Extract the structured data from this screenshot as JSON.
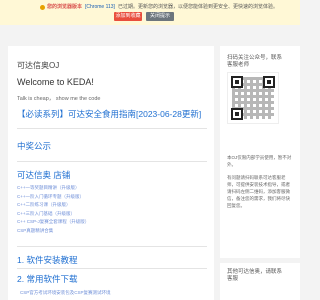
{
  "warning": {
    "title": "您的浏览器版本",
    "browser": "[Chrome 113]",
    "text": "已过期。更新您的浏览器，以便您能体验到更安全、更快速的浏览体验。",
    "add_fav_label": "添加到收藏",
    "close_label": "关闭提示"
  },
  "main": {
    "site_title": "可达信奥OJ",
    "welcome": "Welcome to KEDA!",
    "motto": "Talk is cheap， show me the code",
    "notice": "【必读系列】可达安全食用指南[2023-06-28更新]",
    "announcement_title": "中奖公示",
    "shop_title": "可达信奥 店铺",
    "shop_items": [
      "C++一等奖题目精讲（升级版）",
      "C++一阶入门循环专题（升级版）",
      "C++二阶练习课（升级版）",
      "C++三阶入门基础（升级版）",
      "C++ CSP-J复赛全套课程（升级版）",
      "CSP真题精讲合集"
    ],
    "section1": "1. 软件安装教程",
    "section2": "2. 常用软件下载",
    "resource_item": "CSP官方考试环境安装包及CSP复赛测试环境"
  },
  "sidebar": {
    "qr_title": "扫码关注公众号，联系客服老师",
    "notice_text": "本OJ仅限内部学员使用，暂不对外。",
    "notice_text2": "有问题请扫码联系可达客服老师，可提供安装技术指导，或者请扫码左侧二维码，添加客服微信，备注您的需求，我们将尽快回复您。",
    "bottom_title": "其他可达信奥，请联系客服"
  }
}
